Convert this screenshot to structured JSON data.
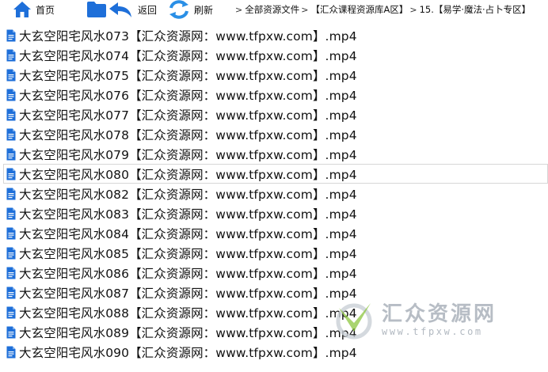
{
  "toolbar": {
    "home_label": "首页",
    "back_label": "返回",
    "refresh_label": "刷新",
    "breadcrumbs": [
      "全部资源文件",
      "【汇众课程资源库A区】",
      "15.【易学·魔法·占卜专区】"
    ]
  },
  "files": [
    "大玄空阳宅风水073【汇众资源网：www.tfpxw.com】.mp4",
    "大玄空阳宅风水074【汇众资源网：www.tfpxw.com】.mp4",
    "大玄空阳宅风水075【汇众资源网：www.tfpxw.com】.mp4",
    "大玄空阳宅风水076【汇众资源网：www.tfpxw.com】.mp4",
    "大玄空阳宅风水077【汇众资源网：www.tfpxw.com】.mp4",
    "大玄空阳宅风水078【汇众资源网：www.tfpxw.com】.mp4",
    "大玄空阳宅风水079【汇众资源网：www.tfpxw.com】.mp4",
    "大玄空阳宅风水080【汇众资源网：www.tfpxw.com】.mp4",
    "大玄空阳宅风水082【汇众资源网：www.tfpxw.com】.mp4",
    "大玄空阳宅风水083【汇众资源网：www.tfpxw.com】.mp4",
    "大玄空阳宅风水084【汇众资源网：www.tfpxw.com】.mp4",
    "大玄空阳宅风水085【汇众资源网：www.tfpxw.com】.mp4",
    "大玄空阳宅风水086【汇众资源网：www.tfpxw.com】.mp4",
    "大玄空阳宅风水087【汇众资源网：www.tfpxw.com】.mp4",
    "大玄空阳宅风水088【汇众资源网：www.tfpxw.com】.mp4",
    "大玄空阳宅风水089【汇众资源网：www.tfpxw.com】.mp4",
    "大玄空阳宅风水090【汇众资源网：www.tfpxw.com】.mp4"
  ],
  "selected_index": 7,
  "watermark": {
    "title": "汇众资源网",
    "url": "www.tfpxw.com"
  },
  "colors": {
    "icon_blue": "#1e6fd9",
    "refresh_blue": "#2a8fe6",
    "watermark_gray": "#9fa8b2",
    "watermark_green": "#8cc63f"
  }
}
